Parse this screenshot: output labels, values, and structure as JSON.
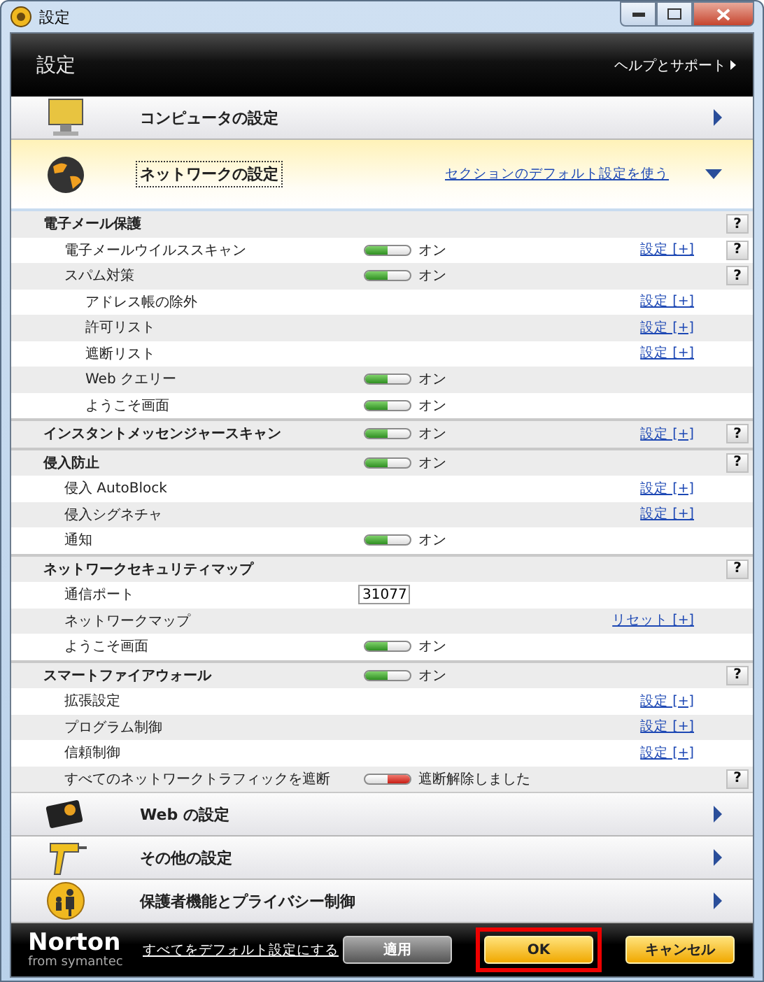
{
  "window": {
    "title": "設定"
  },
  "header": {
    "title": "設定",
    "help_link": "ヘルプとサポート"
  },
  "sections": [
    {
      "kind": "monitor",
      "label": "コンピュータの設定",
      "expanded": false
    },
    {
      "kind": "globe",
      "label": "ネットワークの設定",
      "expanded": true,
      "focused": true,
      "default_link": "セクションのデフォルト設定を使う",
      "groups": [
        {
          "label": "電子メール保護",
          "help": "?",
          "children": [
            {
              "label": "電子メールウイルススキャン",
              "toggle": {
                "on": true,
                "text": "オン"
              },
              "link": "設定 [+]",
              "help": "?"
            },
            {
              "label": "スパム対策",
              "toggle": {
                "on": true,
                "text": "オン"
              },
              "help": "?",
              "children": [
                {
                  "label": "アドレス帳の除外",
                  "link": "設定 [+]"
                },
                {
                  "label": "許可リスト",
                  "link": "設定 [+]"
                },
                {
                  "label": "遮断リスト",
                  "link": "設定 [+]"
                },
                {
                  "label": "Web クエリー",
                  "toggle": {
                    "on": true,
                    "text": "オン"
                  }
                },
                {
                  "label": "ようこそ画面",
                  "toggle": {
                    "on": true,
                    "text": "オン"
                  }
                }
              ]
            }
          ]
        },
        {
          "label": "インスタントメッセンジャースキャン",
          "toggle": {
            "on": true,
            "text": "オン"
          },
          "link": "設定 [+]",
          "help": "?"
        },
        {
          "label": "侵入防止",
          "toggle": {
            "on": true,
            "text": "オン"
          },
          "help": "?",
          "children": [
            {
              "label": "侵入 AutoBlock",
              "link": "設定 [+]"
            },
            {
              "label": "侵入シグネチャ",
              "link": "設定 [+]"
            },
            {
              "label": "通知",
              "toggle": {
                "on": true,
                "text": "オン"
              }
            }
          ]
        },
        {
          "label": "ネットワークセキュリティマップ",
          "help": "?",
          "children": [
            {
              "label": "通信ポート",
              "port": "31077"
            },
            {
              "label": "ネットワークマップ",
              "link": "リセット [+]"
            },
            {
              "label": "ようこそ画面",
              "toggle": {
                "on": true,
                "text": "オン"
              }
            }
          ]
        },
        {
          "label": "スマートファイアウォール",
          "toggle": {
            "on": true,
            "text": "オン"
          },
          "help": "?",
          "children": [
            {
              "label": "拡張設定",
              "link": "設定 [+]"
            },
            {
              "label": "プログラム制御",
              "link": "設定 [+]"
            },
            {
              "label": "信頼制御",
              "link": "設定 [+]"
            },
            {
              "label": "すべてのネットワークトラフィックを遮断",
              "toggle": {
                "on": false,
                "text": "遮断解除しました"
              },
              "help": "?"
            }
          ]
        }
      ]
    },
    {
      "kind": "web",
      "label": "Web の設定",
      "expanded": false
    },
    {
      "kind": "tool",
      "label": "その他の設定",
      "expanded": false
    },
    {
      "kind": "family",
      "label": "保護者機能とプライバシー制御",
      "expanded": false
    }
  ],
  "footer": {
    "logo": "Norton",
    "logo_sub": "from symantec",
    "reset_link": "すべてをデフォルト設定にする",
    "buttons": [
      {
        "label": "適用",
        "kind": "secondary",
        "highlighted": false
      },
      {
        "label": "OK",
        "kind": "primary",
        "highlighted": true
      },
      {
        "label": "キャンセル",
        "kind": "primary",
        "highlighted": false
      }
    ]
  }
}
